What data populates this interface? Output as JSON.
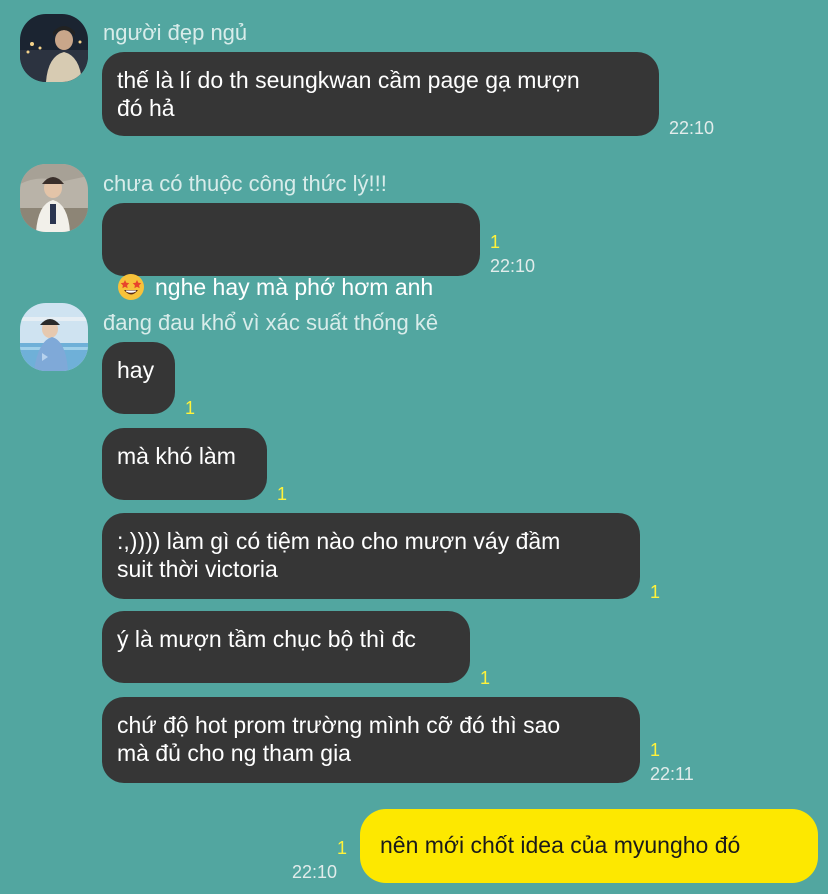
{
  "conversation": {
    "groups": [
      {
        "sender": "người đẹp ngủ",
        "messages": [
          {
            "text": "thế là lí do th seungkwan cầm page gạ mượn\nđó hả",
            "unread": "",
            "time": "22:10"
          }
        ]
      },
      {
        "sender": "chưa có thuộc công thức lý!!!",
        "messages": [
          {
            "text": "nghe hay mà phớ hơm anh",
            "unread": "1",
            "time": "22:10"
          }
        ]
      },
      {
        "sender": "đang đau khổ vì xác suất thống kê",
        "messages": [
          {
            "text": "hay",
            "unread": "1",
            "time": ""
          },
          {
            "text": "mà khó làm",
            "unread": "1",
            "time": ""
          },
          {
            "text": ":,)))) làm gì có tiệm nào cho mượn váy đầm\nsuit thời victoria",
            "unread": "1",
            "time": ""
          },
          {
            "text": "ý là mượn tầm chục bộ thì đc",
            "unread": "1",
            "time": ""
          },
          {
            "text": "chứ độ hot prom trường mình cỡ đó thì sao\nmà đủ cho ng tham gia",
            "unread": "1",
            "time": "22:11"
          }
        ]
      }
    ],
    "my_message": {
      "text": "nên mới chốt idea của myungho đó",
      "unread": "1",
      "time": "22:10"
    }
  },
  "colors": {
    "background": "#52a6a0",
    "bubble_other": "#363636",
    "bubble_me": "#fde800",
    "unread": "#fff23a"
  },
  "icons": {
    "emoji": "star-struck-emoji-icon"
  }
}
